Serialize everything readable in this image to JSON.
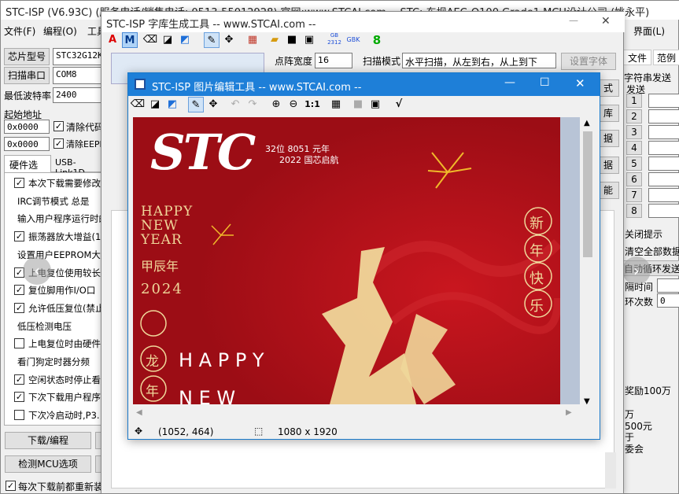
{
  "main": {
    "title": "STC-ISP (V6.93C) (服务电话/销售电话: 0513-55012928) 官网:www.STCAI.com  -- STC: 东坝AEC-Q100 Grade1 MCU设计公司 (姚永平)",
    "menu": [
      "文件(F)",
      "编程(O)",
      "工具",
      "界面(L)"
    ],
    "chip_label": "芯片型号",
    "chip_value": "STC32G12K128",
    "port_label": "扫描串口",
    "port_value": "COM8",
    "baud_label": "最低波特率",
    "baud_value": "2400",
    "start_label": "起始地址",
    "addr1": "0x0000",
    "addr2": "0x0000",
    "clear_code": "清除代码",
    "clear_eeprom": "清除EEPROM",
    "tabs": [
      "硬件选项",
      "USB-Link1D"
    ],
    "options": [
      {
        "text": "本次下载需要修改",
        "checked": true
      },
      {
        "text": "IRC调节模式  总是",
        "checked": null
      },
      {
        "text": "输入用户程序运行时的",
        "checked": null
      },
      {
        "text": "振荡器放大增益(1",
        "checked": true
      },
      {
        "text": "设置用户EEPROM大小",
        "checked": null
      },
      {
        "text": "上电复位使用较长",
        "checked": true
      },
      {
        "text": "复位脚用作I/O口",
        "checked": true
      },
      {
        "text": "允许低压复位(禁止",
        "checked": true
      },
      {
        "text": "低压检测电压",
        "checked": null
      },
      {
        "text": "上电复位时由硬件",
        "checked": false
      },
      {
        "text": "看门狗定时器分频",
        "checked": null
      },
      {
        "text": "空闲状态时停止看",
        "checked": true
      },
      {
        "text": "下次下载用户程序",
        "checked": true
      },
      {
        "text": "下次冷启动时,P3.",
        "checked": false
      }
    ],
    "download_button": "下载/编程",
    "detect_button": "检测MCU选项",
    "every_download": "每次下载前都重新装",
    "right_tabs": [
      "文件",
      "范例"
    ],
    "right_header": "字符串发送",
    "right_send": "发送",
    "rows": [
      "1",
      "2",
      "3",
      "4",
      "5",
      "6",
      "7",
      "8"
    ],
    "right_texts": [
      "关闭提示",
      "清空全部数据",
      "自动循环发送",
      "隔时间",
      "环次数",
      "0"
    ],
    "promo": [
      "奖励100万",
      "万",
      "500元",
      "于",
      "委会"
    ]
  },
  "font_tool": {
    "title": "STC-ISP 字库生成工具 -- www.STCAI.com --",
    "dot_width_label": "点阵宽度",
    "dot_width_value": "16",
    "scan_mode_label": "扫描模式",
    "scan_mode_value": "水平扫描，从左到右，从上到下",
    "set_font_button": "设置字体",
    "side_buttons": [
      "式",
      "库",
      "据",
      "据",
      "能"
    ],
    "toolbar_icons": [
      "font-color-icon",
      "font-bold-icon",
      "eraser-icon",
      "fill-icon",
      "replace-icon",
      "pencil-icon",
      "move-icon",
      "grid-icon",
      "open-icon",
      "save-icon",
      "saveas-icon",
      "gb2312-icon",
      "gbk-icon",
      "digit-icon"
    ],
    "gb_label": "GB\n2312",
    "gbk_label": "GBK",
    "digit_label": "8"
  },
  "image_editor": {
    "title": "STC-ISP 图片编辑工具 -- www.STCAI.com --",
    "status_coords": "(1052, 464)",
    "status_size": "1080 x 1920",
    "zoom_reset": "1:1",
    "image": {
      "logo": "STC",
      "sub1": "32位 8051 元年",
      "sub2": "2022 国芯启航",
      "happy": "HAPPY",
      "new": "NEW",
      "year": "YEAR",
      "jiachen": "甲辰年",
      "yr": "2024",
      "xin": "新",
      "nian": "年",
      "kuai": "快",
      "le": "乐",
      "long": "龙",
      "nian2": "年",
      "happy_spaced": "H A P P Y",
      "new_spaced": "N E W"
    }
  },
  "colors": {
    "title_blue": "#1e7fd8",
    "poster_red": "#b3111a",
    "gold": "#efd79a"
  }
}
